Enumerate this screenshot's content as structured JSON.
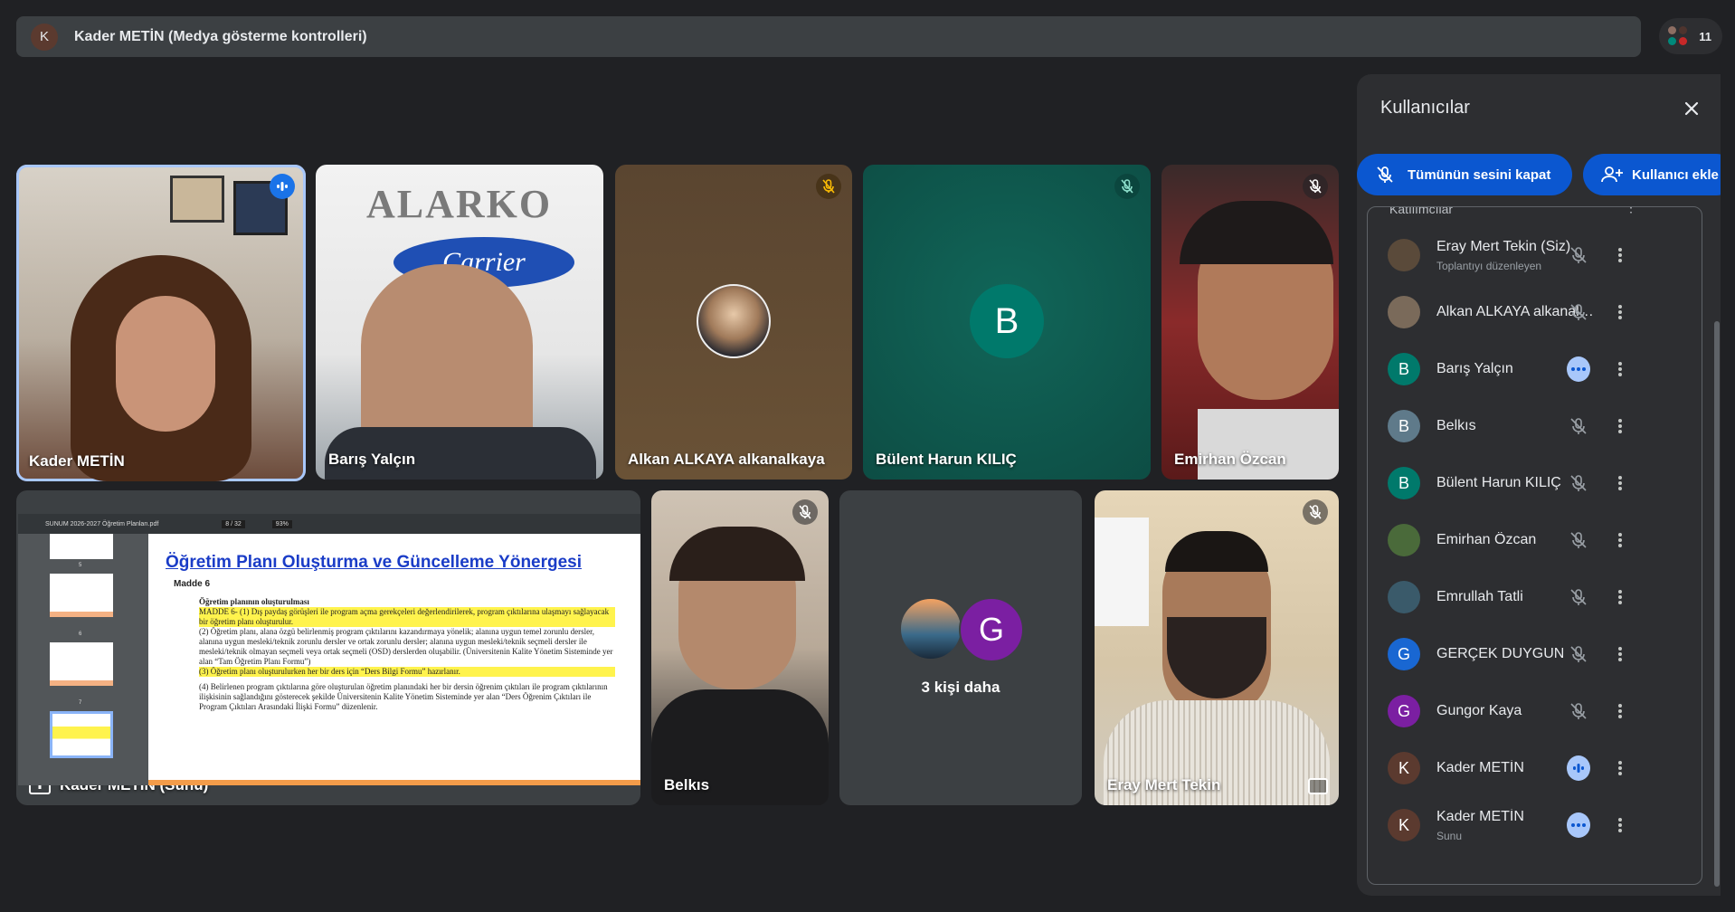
{
  "header": {
    "avatar_letter": "K",
    "title": "Kader METİN (Medya gösterme kontrolleri)",
    "participant_count": "11"
  },
  "tiles": {
    "kader": {
      "name": "Kader METİN"
    },
    "baris": {
      "name": "Barış Yalçın",
      "logo_top": "ALARKO",
      "logo_bottom": "Carrier"
    },
    "alkan": {
      "name": "Alkan ALKAYA alkanalkaya"
    },
    "bulent": {
      "name": "Bülent Harun KILIÇ",
      "avatar_letter": "B"
    },
    "emirhan": {
      "name": "Emirhan Özcan"
    },
    "presentation": {
      "name": "Kader METİN (Sunu)",
      "file_name": "SUNUM 2026-2027 Öğretim Planları.pdf",
      "page": "8 / 32",
      "zoom": "93%",
      "heading": "Öğretim Planı Oluşturma ve Güncelleme Yönergesi",
      "article": "Madde 6",
      "subheading": "Öğretim planının oluşturulması",
      "paragraph1": "MADDE 6- (1) Dış paydaş görüşleri ile program açma gerekçeleri değerlendirilerek, program çıktılarına ulaşmayı sağlayacak bir öğretim planı oluşturulur.",
      "paragraph2": "(2) Öğretim planı, alana özgü belirlenmiş program çıktılarını kazandırmaya yönelik; alanına uygun temel zorunlu dersler, alanına uygun mesleki/teknik zorunlu dersler ve ortak zorunlu dersler; alanına uygun mesleki/teknik seçmeli dersler ile mesleki/teknik olmayan seçmeli veya ortak seçmeli (OSD) derslerden oluşabilir. (Üniversitenin Kalite Yönetim Sisteminde yer alan “Tam Öğretim Planı Formu”)",
      "paragraph3": "(3) Öğretim planı oluşturulurken her bir ders için “Ders Bilgi Formu” hazırlanır.",
      "paragraph4": "(4) Belirlenen program çıktılarına göre oluşturulan öğretim planındaki her bir dersin öğrenim çıktıları ile program çıktılarının ilişkisinin sağlandığını gösterecek şekilde Üniversitenin Kalite Yönetim Sisteminde yer alan “Ders Öğrenim Çıktıları ile Program Çıktıları Arasındaki İlişki Formu” düzenlenir.",
      "thumb_numbers": [
        "5",
        "6",
        "7"
      ]
    },
    "belkis": {
      "name": "Belkıs"
    },
    "more": {
      "avatar_letter": "G",
      "label": "3 kişi daha"
    },
    "eray": {
      "name": "Eray Mert Tekin"
    }
  },
  "panel": {
    "title": "Kullanıcılar",
    "mute_all_label": "Tümünün sesini kapat",
    "add_user_label": "Kullanıcı ekle",
    "section_label": "Katılımcılar",
    "participants": [
      {
        "name": "Eray Mert Tekin (Siz)",
        "sub": "Toplantıyı düzenleyen",
        "letter": "",
        "color": "#5a4a3a",
        "status": "muted"
      },
      {
        "name": "Alkan ALKAYA alkanalka...",
        "sub": "",
        "letter": "",
        "color": "#7a6a5a",
        "status": "muted"
      },
      {
        "name": "Barış Yalçın",
        "sub": "",
        "letter": "B",
        "color": "#00796b",
        "status": "more"
      },
      {
        "name": "Belkıs",
        "sub": "",
        "letter": "B",
        "color": "#5f7a8a",
        "status": "muted"
      },
      {
        "name": "Bülent Harun KILIÇ",
        "sub": "",
        "letter": "B",
        "color": "#00796b",
        "status": "muted"
      },
      {
        "name": "Emirhan Özcan",
        "sub": "",
        "letter": "",
        "color": "#4a6a3a",
        "status": "muted"
      },
      {
        "name": "Emrullah Tatli",
        "sub": "",
        "letter": "",
        "color": "#3a5a6a",
        "status": "muted"
      },
      {
        "name": "GERÇEK DUYGUN",
        "sub": "",
        "letter": "G",
        "color": "#1967d2",
        "status": "muted"
      },
      {
        "name": "Gungor Kaya",
        "sub": "",
        "letter": "G",
        "color": "#7b1fa2",
        "status": "muted"
      },
      {
        "name": "Kader METİN",
        "sub": "",
        "letter": "K",
        "color": "#5b3a2f",
        "status": "speaking"
      },
      {
        "name": "Kader METİN",
        "sub": "Sunu",
        "letter": "K",
        "color": "#5b3a2f",
        "status": "more"
      }
    ]
  }
}
